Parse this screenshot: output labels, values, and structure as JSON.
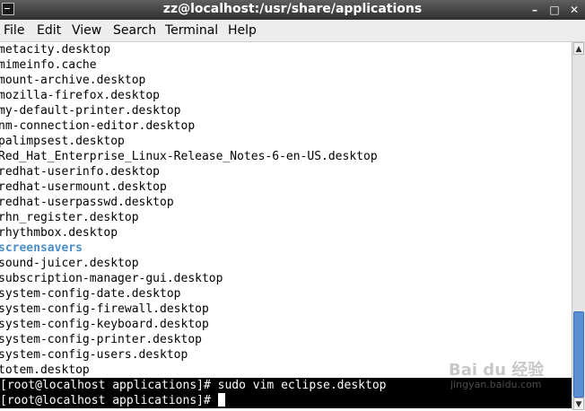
{
  "window": {
    "title": "zz@localhost:/usr/share/applications",
    "buttons": {
      "minimize_icon": "minimize-icon",
      "maximize_icon": "maximize-icon",
      "close_icon": "close-icon"
    }
  },
  "menubar": {
    "items": [
      "File",
      "Edit",
      "View",
      "Search",
      "Terminal",
      "Help"
    ]
  },
  "terminal": {
    "lines": [
      "metacity.desktop",
      "mimeinfo.cache",
      "mount-archive.desktop",
      "mozilla-firefox.desktop",
      "my-default-printer.desktop",
      "nm-connection-editor.desktop",
      "palimpsest.desktop",
      "Red_Hat_Enterprise_Linux-Release_Notes-6-en-US.desktop",
      "redhat-userinfo.desktop",
      "redhat-usermount.desktop",
      "redhat-userpasswd.desktop",
      "rhn_register.desktop",
      "rhythmbox.desktop",
      "screensavers",
      "sound-juicer.desktop",
      "subscription-manager-gui.desktop",
      "system-config-date.desktop",
      "system-config-firewall.desktop",
      "system-config-keyboard.desktop",
      "system-config-printer.desktop",
      "system-config-users.desktop",
      "totem.desktop"
    ],
    "command_line": "[root@localhost applications]# sudo vim eclipse.desktop",
    "prompt_line": "[root@localhost applications]# ",
    "colors": {
      "directory": "#4a8fc8",
      "prompt_bg": "#000000",
      "prompt_fg": "#ffffff"
    }
  },
  "scrollbar": {
    "up_icon": "scroll-up-arrow-icon",
    "down_icon": "scroll-down-arrow-icon",
    "thumb_color": "#5a8fd6"
  },
  "watermark": {
    "logo": "Bai du 经验",
    "url": "jingyan.baidu.com"
  }
}
